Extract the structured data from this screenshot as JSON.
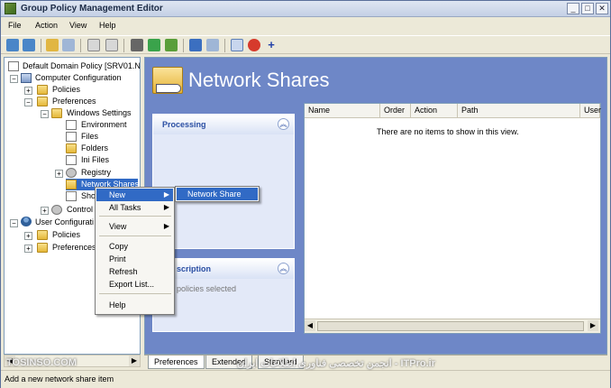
{
  "window": {
    "title": "Group Policy Management Editor"
  },
  "menu": [
    "File",
    "Action",
    "View",
    "Help"
  ],
  "tree": {
    "root": "Default Domain Policy [SRV01.N",
    "computer_config": "Computer Configuration",
    "policies": "Policies",
    "preferences": "Preferences",
    "windows_settings": "Windows Settings",
    "environment": "Environment",
    "files": "Files",
    "folders": "Folders",
    "ini_files": "Ini Files",
    "registry": "Registry",
    "network_shares": "Network Shares",
    "shortcuts": "Sho",
    "control_panel": "Control",
    "user_config": "User Configurati",
    "user_policies": "Policies",
    "user_preferences": "Preferences"
  },
  "main": {
    "title": "Network Shares",
    "processing_title": "Processing",
    "description_title": "scription",
    "description_body": "policies selected",
    "columns": [
      "Name",
      "Order",
      "Action",
      "Path",
      "User"
    ],
    "empty_message": "There are no items to show in this view."
  },
  "tabs": [
    "Preferences",
    "Extended",
    "Standard"
  ],
  "context_menu": {
    "items": [
      "New",
      "All Tasks",
      "View",
      "Copy",
      "Print",
      "Refresh",
      "Export List...",
      "Help"
    ],
    "submenu_item": "Network Share"
  },
  "status": "Add a new network share item",
  "watermark_left": "TOSINSO.COM",
  "watermark_right": "انجمن تخصصی فناوری اطلاعات ایران - ITPro.ir"
}
